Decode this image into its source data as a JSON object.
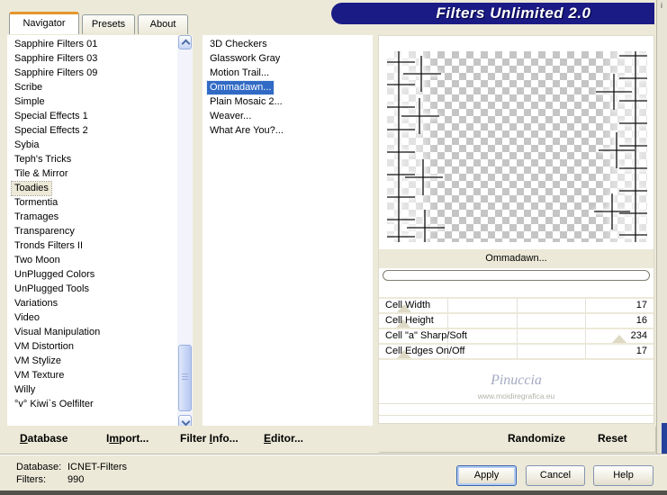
{
  "window": {
    "title": "Filters Unlimited 2.0",
    "buttons": {
      "apply": "Apply",
      "cancel": "Cancel",
      "help": "Help"
    },
    "status": {
      "database_label": "Database:",
      "database_value": "ICNET-Filters",
      "filters_label": "Filters:",
      "filters_value": "990"
    },
    "background_edge_glyph": "i"
  },
  "tabs": [
    {
      "label": "Navigator",
      "active": true
    },
    {
      "label": "Presets",
      "active": false
    },
    {
      "label": "About",
      "active": false
    }
  ],
  "categories": {
    "selected": "Toadies",
    "items": [
      "Sapphire Filters 01",
      "Sapphire Filters 03",
      "Sapphire Filters 09",
      "Scribe",
      "Simple",
      "Special Effects 1",
      "Special Effects 2",
      "Sybia",
      "Teph's Tricks",
      "Tile & Mirror",
      "Toadies",
      "Tormentia",
      "Tramages",
      "Transparency",
      "Tronds Filters II",
      "Two Moon",
      "UnPlugged Colors",
      "UnPlugged Tools",
      "Variations",
      "Video",
      "Visual Manipulation",
      "VM Distortion",
      "VM Stylize",
      "VM Texture",
      "Willy",
      "°v° Kiwi`s Oelfilter"
    ]
  },
  "filters": {
    "selected": "Ommadawn...",
    "items": [
      "3D Checkers",
      "Glasswork Gray",
      "Motion Trail...",
      "Ommadawn...",
      "Plain Mosaic 2...",
      "Weaver...",
      "What Are You?..."
    ]
  },
  "preview": {
    "selected_filter_label": "Ommadawn...",
    "progress_percent": 0,
    "pattern": "transparent-checkerboard-with-cross-marks"
  },
  "controls": {
    "sliders": [
      {
        "label": "Cell Width",
        "value": 17,
        "max": 255
      },
      {
        "label": "Cell Height",
        "value": 16,
        "max": 255
      },
      {
        "label": "Cell \"a\" Sharp/Soft",
        "value": 234,
        "max": 255
      },
      {
        "label": "Cell Edges On/Off",
        "value": 17,
        "max": 255
      }
    ],
    "randomize_label": "Randomize",
    "reset_label": "Reset"
  },
  "toolbar": {
    "items": [
      {
        "pre": "",
        "mn": "D",
        "post": "atabase"
      },
      {
        "pre": "I",
        "mn": "m",
        "post": "port..."
      },
      {
        "pre": "Filter ",
        "mn": "I",
        "post": "nfo..."
      },
      {
        "pre": "",
        "mn": "E",
        "post": "ditor..."
      }
    ]
  },
  "watermark": {
    "name": "Pinuccia",
    "url": "www.mоidiregrafica.eu"
  },
  "colors": {
    "dialog_beige": "#ece9d8",
    "banner_navy": "#1b1b86",
    "selection_blue": "#316ac5",
    "tab_accent_orange": "#e5962c"
  }
}
